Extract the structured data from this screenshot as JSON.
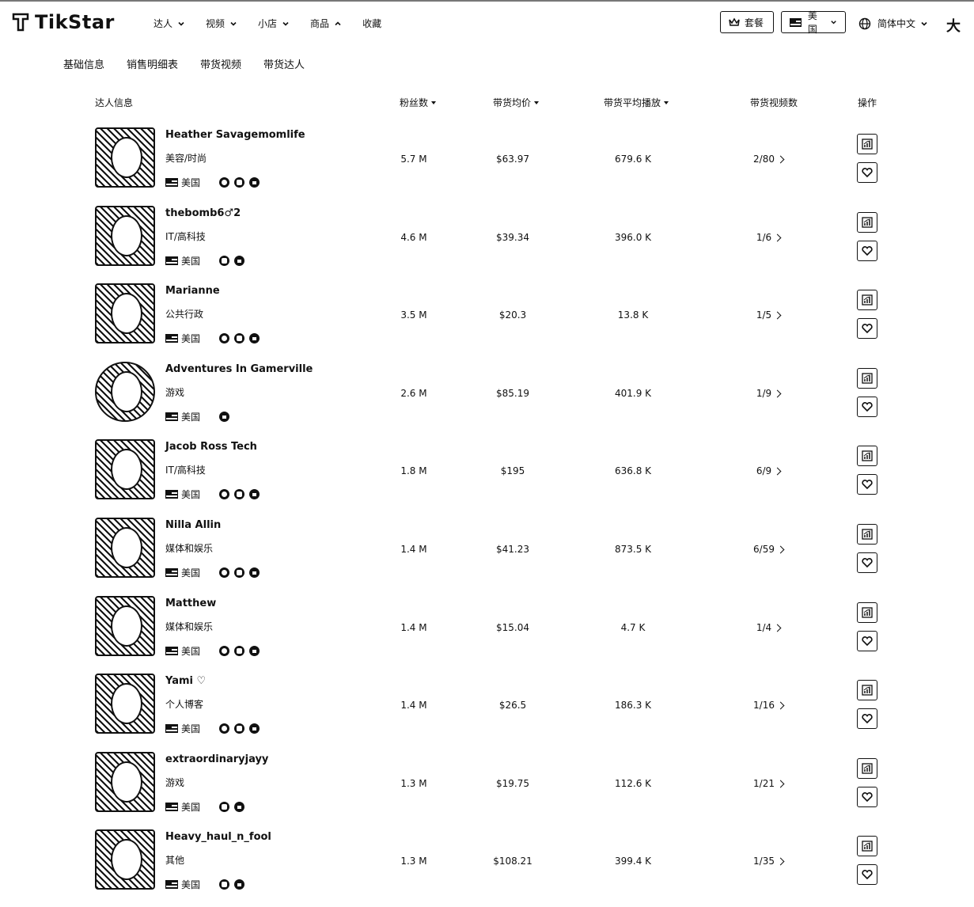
{
  "app": {
    "brand": "TikStar"
  },
  "nav": {
    "items": [
      {
        "label": "达人",
        "chevron": "down"
      },
      {
        "label": "视频",
        "chevron": "down"
      },
      {
        "label": "小店",
        "chevron": "down"
      },
      {
        "label": "商品",
        "chevron": "up"
      },
      {
        "label": "收藏",
        "chevron": ""
      }
    ]
  },
  "header_right": {
    "plan_label": "套餐",
    "region_label": "美国",
    "language_label": "简体中文",
    "user_initial": "大"
  },
  "subtabs": [
    "基础信息",
    "销售明细表",
    "带货视频",
    "带货达人"
  ],
  "table": {
    "headers": {
      "influencer": "达人信息",
      "followers": "粉丝数",
      "avg_price": "带货均价",
      "avg_views": "带货平均播放",
      "videos": "带货视频数",
      "actions": "操作"
    },
    "rows": [
      {
        "name": "Heather Savagemomlife",
        "category": "美容/时尚",
        "region": "美国",
        "socials": [
          "email",
          "instagram",
          "youtube"
        ],
        "followers": "5.7 M",
        "avg_price": "$63.97",
        "avg_views": "679.6 K",
        "videos": "2/80"
      },
      {
        "name": "thebomb6♂2",
        "category": "IT/高科技",
        "region": "美国",
        "socials": [
          "instagram",
          "youtube"
        ],
        "followers": "4.6 M",
        "avg_price": "$39.34",
        "avg_views": "396.0 K",
        "videos": "1/6"
      },
      {
        "name": "Marianne",
        "category": "公共行政",
        "region": "美国",
        "socials": [
          "email",
          "instagram",
          "youtube"
        ],
        "followers": "3.5 M",
        "avg_price": "$20.3",
        "avg_views": "13.8 K",
        "videos": "1/5"
      },
      {
        "name": "Adventures In Gamerville",
        "category": "游戏",
        "region": "美国",
        "socials": [
          "youtube"
        ],
        "followers": "2.6 M",
        "avg_price": "$85.19",
        "avg_views": "401.9 K",
        "videos": "1/9"
      },
      {
        "name": "Jacob Ross Tech",
        "category": "IT/高科技",
        "region": "美国",
        "socials": [
          "email",
          "instagram",
          "youtube"
        ],
        "followers": "1.8 M",
        "avg_price": "$195",
        "avg_views": "636.8 K",
        "videos": "6/9"
      },
      {
        "name": "Nilla Allin",
        "category": "媒体和娱乐",
        "region": "美国",
        "socials": [
          "email",
          "instagram",
          "youtube"
        ],
        "followers": "1.4 M",
        "avg_price": "$41.23",
        "avg_views": "873.5 K",
        "videos": "6/59"
      },
      {
        "name": "Matthew",
        "category": "媒体和娱乐",
        "region": "美国",
        "socials": [
          "email",
          "instagram",
          "youtube"
        ],
        "followers": "1.4 M",
        "avg_price": "$15.04",
        "avg_views": "4.7 K",
        "videos": "1/4"
      },
      {
        "name": "Yami ♡",
        "category": "个人博客",
        "region": "美国",
        "socials": [
          "email",
          "instagram",
          "youtube"
        ],
        "followers": "1.4 M",
        "avg_price": "$26.5",
        "avg_views": "186.3 K",
        "videos": "1/16"
      },
      {
        "name": "extraordinaryjayy",
        "category": "游戏",
        "region": "美国",
        "socials": [
          "instagram",
          "youtube"
        ],
        "followers": "1.3 M",
        "avg_price": "$19.75",
        "avg_views": "112.6 K",
        "videos": "1/21"
      },
      {
        "name": "Heavy_haul_n_fool",
        "category": "其他",
        "region": "美国",
        "socials": [
          "instagram",
          "youtube"
        ],
        "followers": "1.3 M",
        "avg_price": "$108.21",
        "avg_views": "399.4 K",
        "videos": "1/35"
      }
    ]
  }
}
